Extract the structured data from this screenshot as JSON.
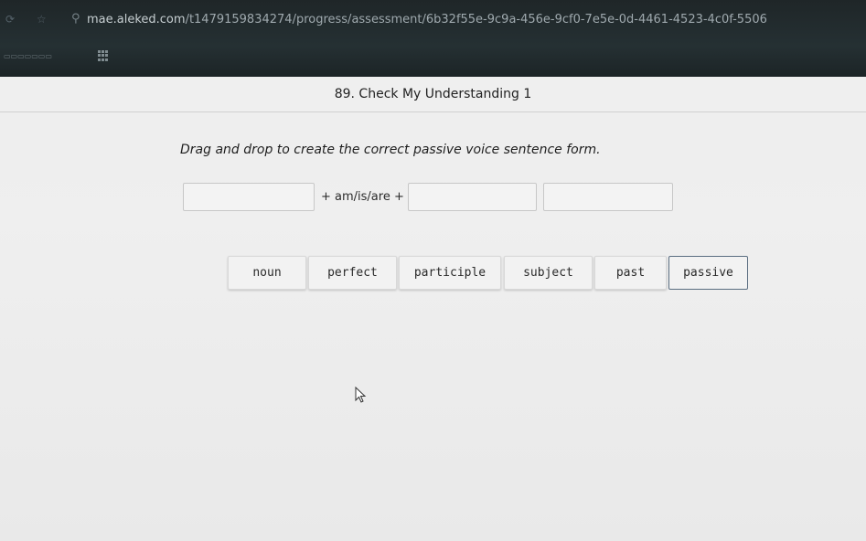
{
  "browser": {
    "url_host": "mae.aleked.com",
    "url_path": "/t1479159834274/progress/assessment/6b32f55e-9c9a-456e-9cf0-7e5e-0d-4461-4523-4c0f-5506"
  },
  "page": {
    "title": "89. Check My Understanding 1",
    "instruction": "Drag and drop to create the correct passive voice sentence form.",
    "connector": "+ am/is/are +"
  },
  "tiles": [
    {
      "label": "noun"
    },
    {
      "label": "perfect"
    },
    {
      "label": "participle"
    },
    {
      "label": "subject"
    },
    {
      "label": "past"
    },
    {
      "label": "passive"
    }
  ],
  "colors": {
    "selected_border": "#5a6d80",
    "browser_bg": "#1f2628"
  }
}
